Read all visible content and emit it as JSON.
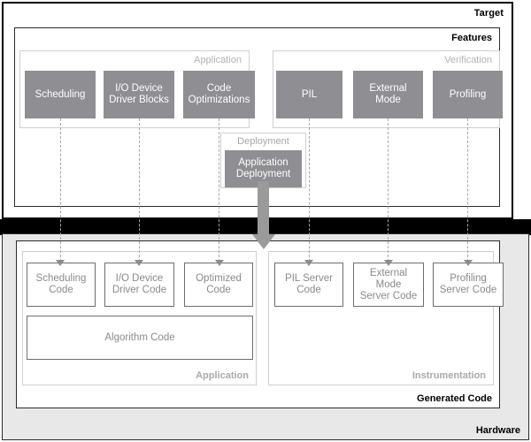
{
  "diagram": {
    "title": "Target",
    "target": {
      "label": "Target",
      "features": {
        "label": "Features",
        "groups": [
          {
            "label": "Application",
            "blocks": [
              {
                "label": "Scheduling"
              },
              {
                "label": "I/O Device\nDriver Blocks"
              },
              {
                "label": "Code\nOptimizations"
              }
            ]
          },
          {
            "label": "Verification",
            "blocks": [
              {
                "label": "PIL"
              },
              {
                "label": "External\nMode"
              },
              {
                "label": "Profiling"
              }
            ]
          }
        ]
      },
      "deployment": {
        "label": "Deployment",
        "block": {
          "label": "Application\nDeployment"
        }
      }
    },
    "hardware": {
      "label": "Hardware",
      "generated_code": {
        "label": "Generated Code",
        "groups": [
          {
            "label": "Application",
            "blocks": [
              {
                "label": "Scheduling\nCode"
              },
              {
                "label": "I/O Device\nDriver Code"
              },
              {
                "label": "Optimized\nCode"
              }
            ],
            "wide_block": {
              "label": "Algorithm Code"
            }
          },
          {
            "label": "Instrumentation",
            "blocks": [
              {
                "label": "PIL Server\nCode"
              },
              {
                "label": "External Mode\nServer Code"
              },
              {
                "label": "Profiling\nServer Code"
              }
            ]
          }
        ]
      }
    },
    "colors": {
      "feature_block_fill": "#8e8e93",
      "feature_block_text": "#ffffff",
      "code_block_border": "#6e6e6e",
      "code_block_text": "#8a8a8a",
      "group_border": "#cfcfcf",
      "group_label": "#b2b2b2",
      "band": "#000000",
      "hardware_fill": "#e8e8e8",
      "arrow": "#9a9a9a",
      "dash": "#a8a8a8"
    }
  }
}
